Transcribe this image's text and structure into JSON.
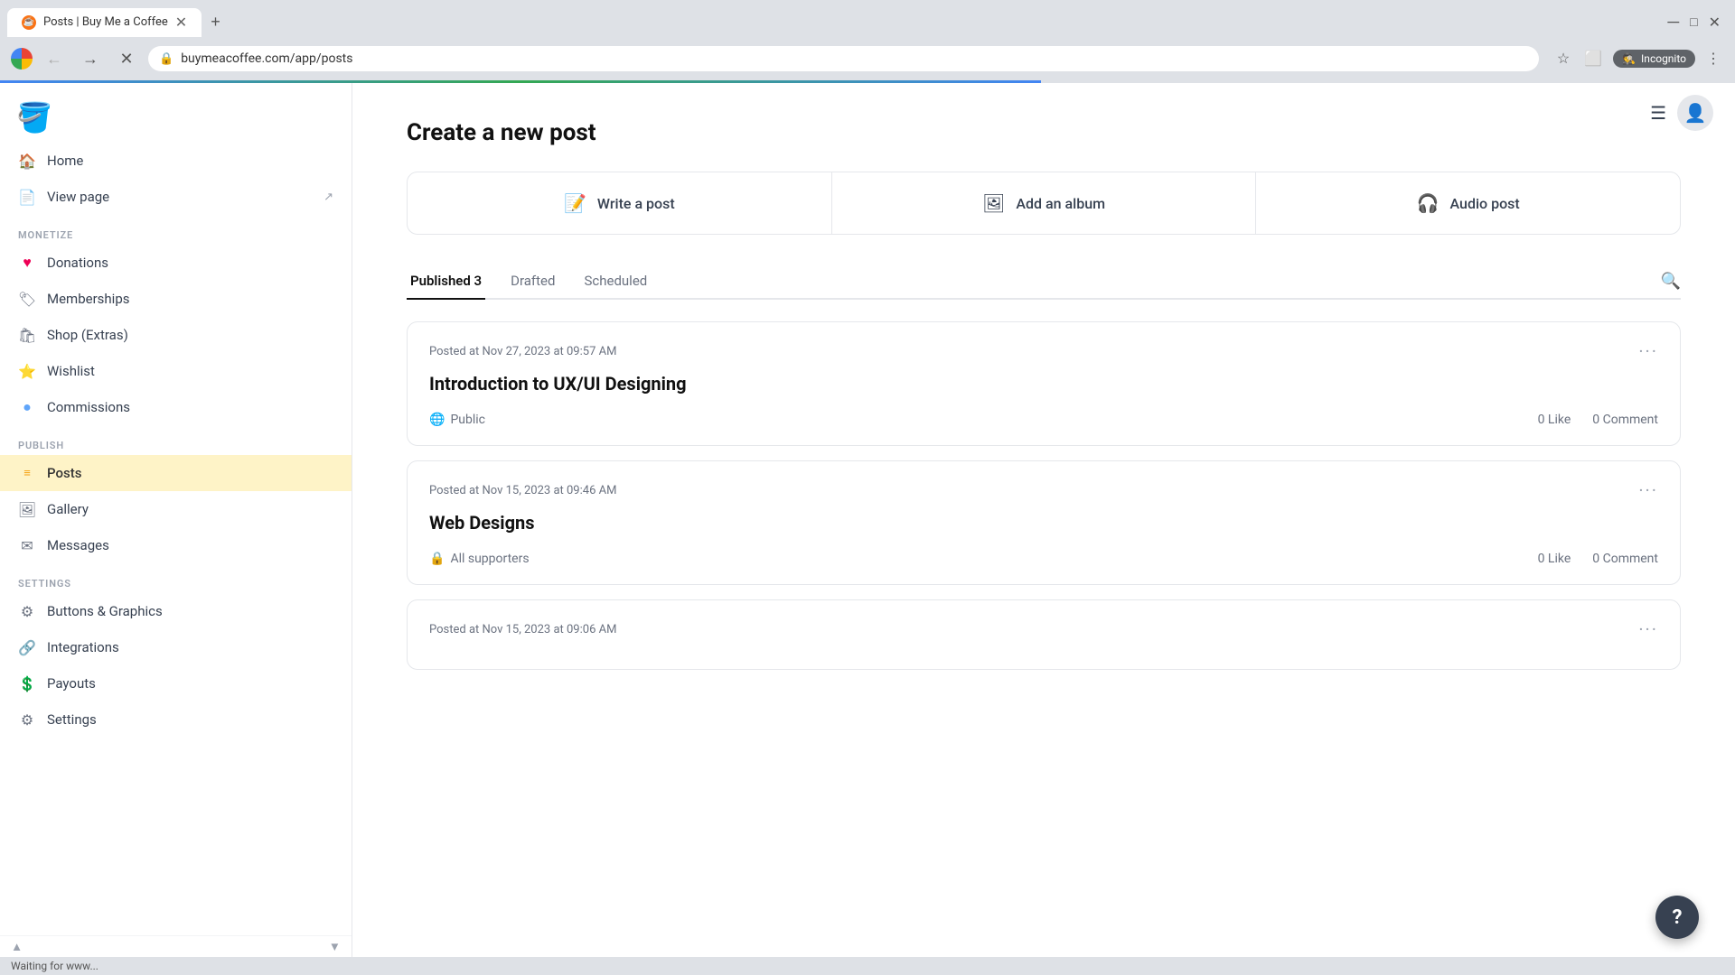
{
  "browser": {
    "tab_title": "Posts | Buy Me a Coffee",
    "url": "buymeacoffee.com/app/posts",
    "loading": true,
    "status_text": "Waiting for www..."
  },
  "app": {
    "logo_emoji": "🪣",
    "top_right": {
      "menu_icon": "☰"
    }
  },
  "sidebar": {
    "nav": [
      {
        "id": "home",
        "label": "Home",
        "icon": "🏠"
      },
      {
        "id": "view-page",
        "label": "View page",
        "icon": "📄",
        "external": true
      }
    ],
    "monetize_label": "MONETIZE",
    "monetize": [
      {
        "id": "donations",
        "label": "Donations",
        "icon": "♥"
      },
      {
        "id": "memberships",
        "label": "Memberships",
        "icon": "🏷"
      },
      {
        "id": "shop",
        "label": "Shop (Extras)",
        "icon": "🛍"
      },
      {
        "id": "wishlist",
        "label": "Wishlist",
        "icon": "⭐"
      },
      {
        "id": "commissions",
        "label": "Commissions",
        "icon": "🔵"
      }
    ],
    "publish_label": "PUBLISH",
    "publish": [
      {
        "id": "posts",
        "label": "Posts",
        "icon": "≡",
        "active": true
      },
      {
        "id": "gallery",
        "label": "Gallery",
        "icon": "🖼"
      },
      {
        "id": "messages",
        "label": "Messages",
        "icon": "✉"
      }
    ],
    "settings_label": "SETTINGS",
    "settings": [
      {
        "id": "buttons-graphics",
        "label": "Buttons & Graphics",
        "icon": "⚙"
      },
      {
        "id": "integrations",
        "label": "Integrations",
        "icon": "🔗"
      },
      {
        "id": "payouts",
        "label": "Payouts",
        "icon": "💲"
      },
      {
        "id": "settings",
        "label": "Settings",
        "icon": "⚙"
      }
    ]
  },
  "main": {
    "page_title": "Create a new post",
    "create_cards": [
      {
        "id": "write-post",
        "label": "Write a post",
        "icon": "📝"
      },
      {
        "id": "add-album",
        "label": "Add an album",
        "icon": "🖼"
      },
      {
        "id": "audio-post",
        "label": "Audio post",
        "icon": "🎧"
      }
    ],
    "tabs": [
      {
        "id": "published",
        "label": "Published 3",
        "active": true
      },
      {
        "id": "drafted",
        "label": "Drafted",
        "active": false
      },
      {
        "id": "scheduled",
        "label": "Scheduled",
        "active": false
      }
    ],
    "posts": [
      {
        "id": "post-1",
        "date": "Posted at Nov 27, 2023 at 09:57 AM",
        "title": "Introduction to UX/UI Designing",
        "visibility": "Public",
        "visibility_icon": "🌐",
        "likes": "0 Like",
        "comments": "0 Comment"
      },
      {
        "id": "post-2",
        "date": "Posted at Nov 15, 2023 at 09:46 AM",
        "title": "Web Designs",
        "visibility": "All supporters",
        "visibility_icon": "🔒",
        "likes": "0 Like",
        "comments": "0 Comment"
      },
      {
        "id": "post-3",
        "date": "Posted at Nov 15, 2023 at 09:06 AM",
        "title": "",
        "visibility": "",
        "visibility_icon": "",
        "likes": "",
        "comments": ""
      }
    ],
    "help_icon": "?"
  }
}
